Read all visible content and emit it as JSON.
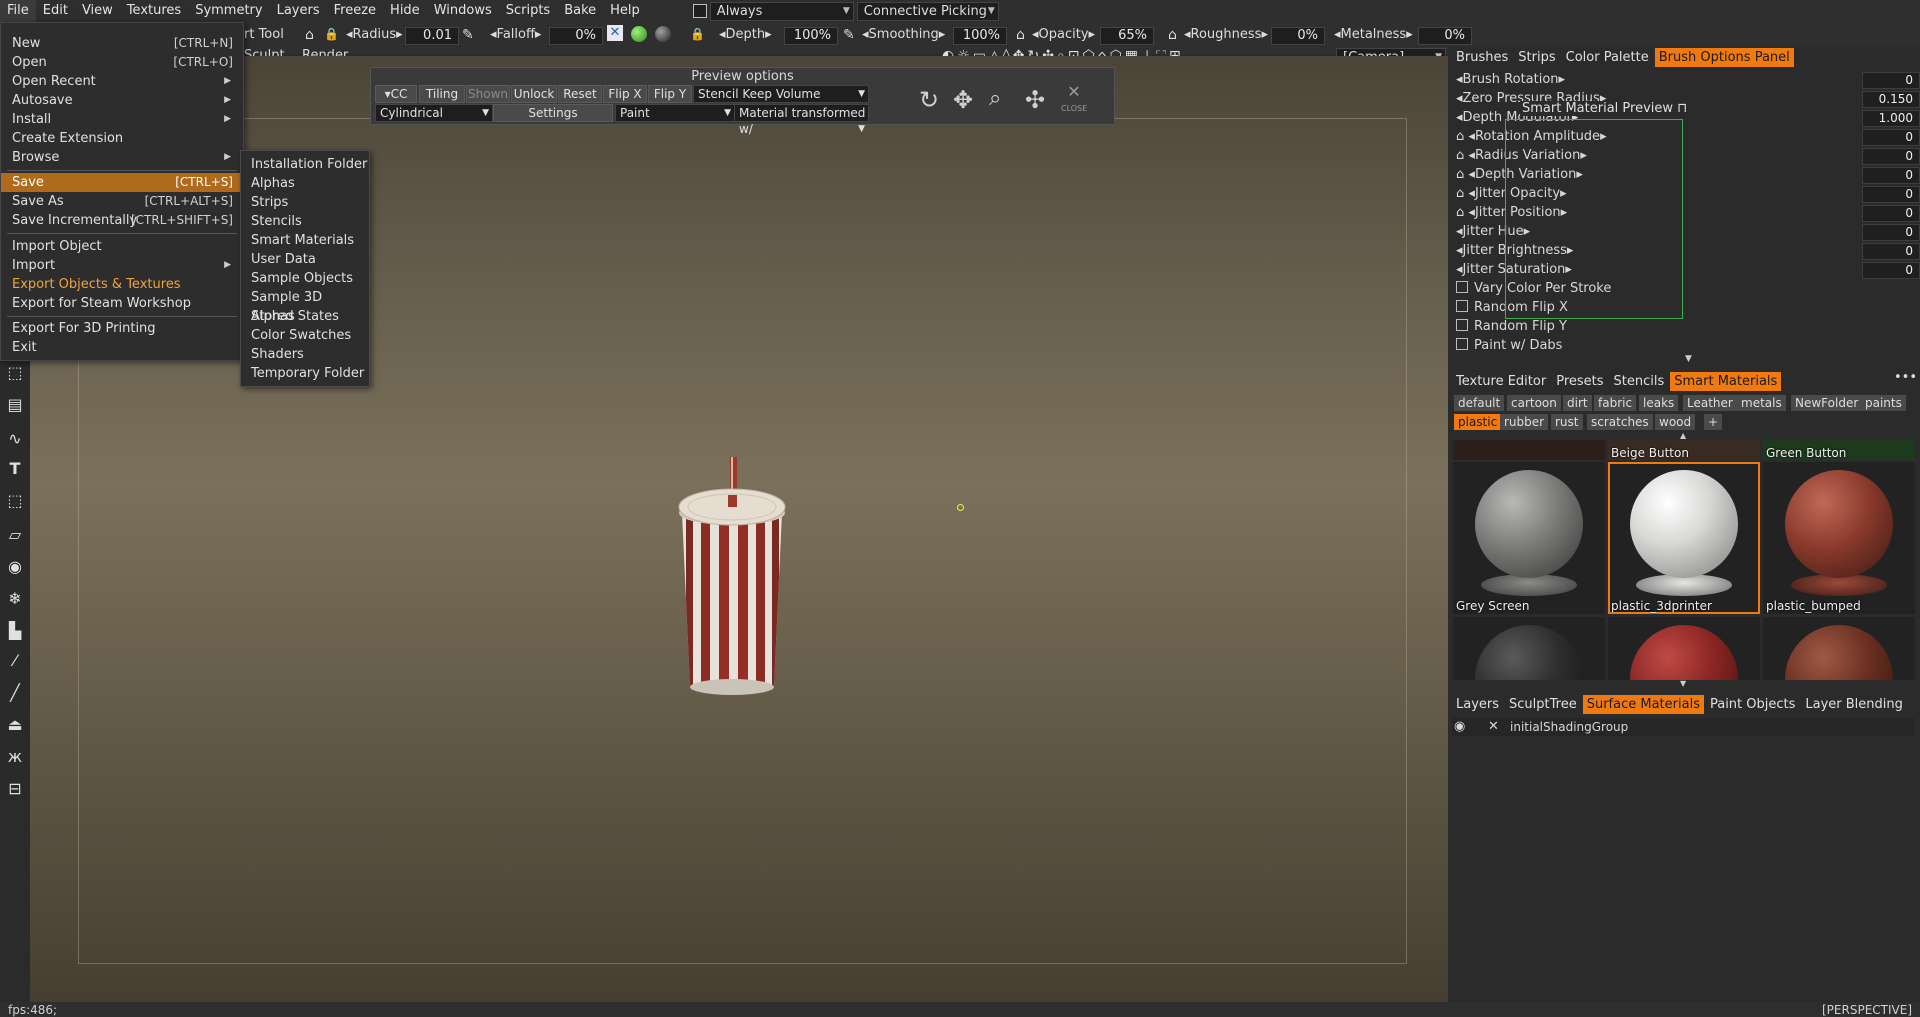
{
  "menubar": {
    "items": [
      "File",
      "Edit",
      "View",
      "Textures",
      "Symmetry",
      "Layers",
      "Freeze",
      "Hide",
      "Windows",
      "Scripts",
      "Bake",
      "Help"
    ],
    "always_label": "Always",
    "picking_label": "Connective Picking"
  },
  "toolbar": {
    "tool_label": "rt Tool",
    "radius_label": "Radius",
    "radius_value": "0.01",
    "falloff_label": "Falloff",
    "falloff_value": "0%",
    "depth_label": "Depth",
    "depth_value": "100%",
    "smoothing_label": "Smoothing",
    "smoothing_value": "100%",
    "opacity_label": "Opacity",
    "opacity_value": "65%",
    "roughness_label": "Roughness",
    "roughness_value": "0%",
    "metalness_label": "Metalness",
    "metalness_value": "0%",
    "camera_label": "[Camera]",
    "sculpt_tab": "Sculpt",
    "render_tab": "Render"
  },
  "file_menu": {
    "items": [
      {
        "label": "New",
        "shortcut": "[CTRL+N]"
      },
      {
        "label": "Open",
        "shortcut": "[CTRL+O]"
      },
      {
        "label": "Open Recent",
        "shortcut": ""
      },
      {
        "label": "Autosave",
        "shortcut": ""
      },
      {
        "label": "Install",
        "shortcut": ""
      },
      {
        "label": "Create Extension",
        "shortcut": ""
      },
      {
        "label": "Browse",
        "shortcut": ""
      },
      {
        "label": "Save",
        "shortcut": "[CTRL+S]"
      },
      {
        "label": "Save As",
        "shortcut": "[CTRL+ALT+S]"
      },
      {
        "label": "Save Incrementally",
        "shortcut": "[CTRL+SHIFT+S]"
      },
      {
        "label": "Import Object",
        "shortcut": ""
      },
      {
        "label": "Import",
        "shortcut": ""
      },
      {
        "label": "Export Objects & Textures",
        "shortcut": ""
      },
      {
        "label": "Export for Steam Workshop",
        "shortcut": ""
      },
      {
        "label": "Export For 3D Printing",
        "shortcut": ""
      },
      {
        "label": "Exit",
        "shortcut": ""
      }
    ]
  },
  "browse_menu": {
    "items": [
      "Installation Folder",
      "Alphas",
      "Strips",
      "Stencils",
      "Smart Materials",
      "User Data",
      "Sample Objects",
      "Sample 3D Alphas",
      "Stored States",
      "Color Swatches",
      "Shaders",
      "Temporary Folder"
    ]
  },
  "preview": {
    "title": "Preview options",
    "cc": "CC",
    "tiling": "Tiling",
    "shown": "Shown",
    "unlock": "Unlock",
    "reset": "Reset",
    "flip_x": "Flip X",
    "flip_y": "Flip Y",
    "stencil_mode": "Stencil Keep Volume",
    "projection": "Cylindrical",
    "settings": "Settings",
    "paint": "Paint",
    "material_mode": "Material transformed w/",
    "close": "CLOSE"
  },
  "brush_tabs": [
    "Brushes",
    "Strips",
    "Color Palette",
    "Brush Options Panel"
  ],
  "brush_options": [
    {
      "label": "Brush Rotation",
      "value": "0"
    },
    {
      "label": "Zero Pressure Radius",
      "value": "0.150"
    },
    {
      "label": "Depth Modulator",
      "value": "1.000"
    },
    {
      "label": "Rotation Amplitude",
      "value": "0"
    },
    {
      "label": "Radius Variation",
      "value": "0"
    },
    {
      "label": "Depth Variation",
      "value": "0"
    },
    {
      "label": "Jitter Opacity",
      "value": "0"
    },
    {
      "label": "Jitter Position",
      "value": "0"
    },
    {
      "label": "Jitter Hue",
      "value": "0"
    },
    {
      "label": "Jitter Brightness",
      "value": "0"
    },
    {
      "label": "Jitter Saturation",
      "value": "0"
    }
  ],
  "brush_checks": [
    "Vary Color Per Stroke",
    "Random Flip X",
    "Random Flip Y",
    "Paint w/ Dabs"
  ],
  "sm_preview_title": "Smart Material Preview",
  "mat_tabs": [
    "Texture Editor",
    "Presets",
    "Stencils",
    "Smart Materials"
  ],
  "mat_tags_row1": [
    "default",
    "cartoon",
    "dirt",
    "fabric",
    "leaks",
    "Leather",
    "metals",
    "NewFolder",
    "paints"
  ],
  "mat_tags_row2": [
    "plastic",
    "rubber",
    "rust",
    "scratches",
    "wood",
    "+"
  ],
  "mat_top_labels": [
    "Beige Button",
    "Green Button"
  ],
  "materials": [
    {
      "name": "Grey Screen",
      "color": "#7a7a78"
    },
    {
      "name": "plastic_3dprinter",
      "color": "#d8d8d6"
    },
    {
      "name": "plastic_bumped",
      "color": "#8a3a2c"
    },
    {
      "name": "",
      "color": "#2e2e2e"
    },
    {
      "name": "",
      "color": "#8a2624"
    },
    {
      "name": "",
      "color": "#6a3022"
    }
  ],
  "layer_tabs": [
    "Layers",
    "SculptTree",
    "Surface Materials",
    "Paint Objects",
    "Layer Blending"
  ],
  "surface_item": "initialShadingGroup",
  "status": {
    "fps": "fps:486;",
    "view": "[PERSPECTIVE]"
  }
}
